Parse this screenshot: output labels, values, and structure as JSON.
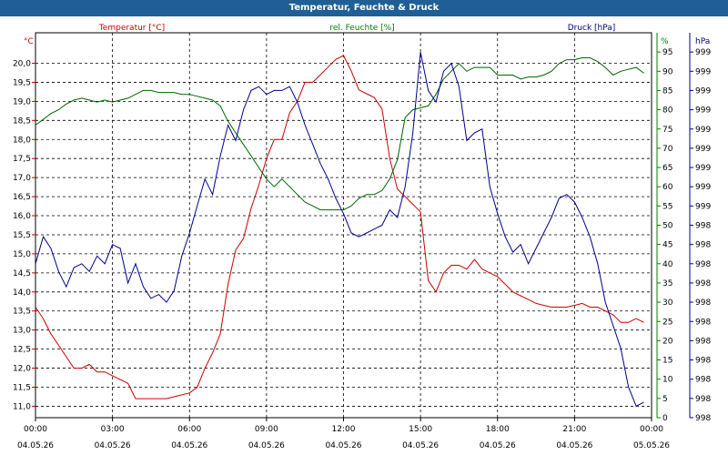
{
  "window": {
    "title": "Temperatur, Feuchte & Druck"
  },
  "chart_data": {
    "type": "line",
    "title": "Temperatur, Feuchte & Druck",
    "x_ticks": [
      {
        "time": "00:00",
        "date": "04.05.26"
      },
      {
        "time": "03:00",
        "date": "04.05.26"
      },
      {
        "time": "06:00",
        "date": "04.05.26"
      },
      {
        "time": "09:00",
        "date": "04.05.26"
      },
      {
        "time": "12:00",
        "date": "04.05.26"
      },
      {
        "time": "15:00",
        "date": "04.05.26"
      },
      {
        "time": "18:00",
        "date": "04.05.26"
      },
      {
        "time": "21:00",
        "date": "04.05.26"
      },
      {
        "time": "00:00",
        "date": "05.05.26"
      }
    ],
    "xlim": [
      0,
      24
    ],
    "axes": {
      "temperature": {
        "label": "Temperatur [°C]",
        "unit": "°C",
        "color": "#cc0000",
        "ylim": [
          10.7,
          20.8
        ],
        "ticks": [
          "11,0",
          "11,5",
          "12,0",
          "12,5",
          "13,0",
          "13,5",
          "14,0",
          "14,5",
          "15,0",
          "15,5",
          "16,0",
          "16,5",
          "17,0",
          "17,5",
          "18,0",
          "18,5",
          "19,0",
          "19,5",
          "20,0"
        ]
      },
      "humidity": {
        "label": "rel. Feuchte [%]",
        "unit": "%",
        "color": "#008000",
        "ylim": [
          0,
          100
        ],
        "ticks": [
          "0",
          "5",
          "10",
          "15",
          "20",
          "25",
          "30",
          "35",
          "40",
          "45",
          "50",
          "55",
          "60",
          "65",
          "70",
          "75",
          "80",
          "85",
          "90",
          "95"
        ]
      },
      "pressure": {
        "label": "Druck [hPa]",
        "unit": "hPa",
        "color": "#000080",
        "ticks": [
          "998",
          "998",
          "998",
          "998",
          "998",
          "998",
          "998",
          "998",
          "998",
          "998",
          "998",
          "999",
          "999",
          "999",
          "999",
          "999",
          "999",
          "999",
          "999",
          "999"
        ]
      }
    },
    "series": [
      {
        "name": "Temperatur [°C]",
        "axis": "temperature",
        "color": "#cc0000",
        "x": [
          0,
          0.3,
          0.6,
          0.9,
          1.2,
          1.5,
          1.8,
          2.1,
          2.4,
          2.7,
          3.0,
          3.3,
          3.6,
          3.9,
          4.2,
          4.5,
          4.8,
          5.1,
          5.4,
          5.7,
          6.0,
          6.3,
          6.6,
          6.9,
          7.2,
          7.5,
          7.8,
          8.1,
          8.4,
          8.7,
          9.0,
          9.3,
          9.6,
          9.9,
          10.2,
          10.5,
          10.8,
          11.1,
          11.4,
          11.7,
          12.0,
          12.3,
          12.6,
          12.9,
          13.2,
          13.5,
          13.8,
          14.1,
          14.4,
          14.7,
          15.0,
          15.3,
          15.6,
          15.9,
          16.2,
          16.5,
          16.8,
          17.1,
          17.4,
          17.7,
          18.0,
          18.3,
          18.6,
          18.9,
          19.2,
          19.5,
          19.8,
          20.1,
          20.4,
          20.7,
          21.0,
          21.3,
          21.6,
          21.9,
          22.2,
          22.5,
          22.8,
          23.1,
          23.4,
          23.7
        ],
        "values": [
          13.6,
          13.3,
          12.9,
          12.6,
          12.3,
          12.0,
          12.0,
          12.1,
          11.9,
          11.9,
          11.8,
          11.7,
          11.6,
          11.2,
          11.2,
          11.2,
          11.2,
          11.2,
          11.25,
          11.3,
          11.35,
          11.5,
          12.0,
          12.4,
          12.9,
          14.2,
          15.1,
          15.4,
          16.2,
          16.8,
          17.5,
          18.0,
          18.0,
          18.7,
          19.0,
          19.5,
          19.5,
          19.7,
          19.9,
          20.1,
          20.2,
          19.8,
          19.3,
          19.2,
          19.1,
          18.8,
          17.5,
          16.7,
          16.5,
          16.3,
          16.1,
          14.3,
          14.0,
          14.5,
          14.7,
          14.7,
          14.6,
          14.85,
          14.6,
          14.5,
          14.4,
          14.2,
          14.0,
          13.9,
          13.8,
          13.7,
          13.65,
          13.6,
          13.6,
          13.6,
          13.65,
          13.7,
          13.6,
          13.6,
          13.5,
          13.4,
          13.2,
          13.2,
          13.3,
          13.2
        ]
      },
      {
        "name": "rel. Feuchte [%]",
        "axis": "humidity",
        "color": "#006400",
        "x": [
          0,
          0.3,
          0.6,
          0.9,
          1.2,
          1.5,
          1.8,
          2.1,
          2.4,
          2.7,
          3.0,
          3.3,
          3.6,
          3.9,
          4.2,
          4.5,
          4.8,
          5.1,
          5.4,
          5.7,
          6.0,
          6.3,
          6.6,
          6.9,
          7.2,
          7.5,
          7.8,
          8.1,
          8.4,
          8.7,
          9.0,
          9.3,
          9.6,
          9.9,
          10.2,
          10.5,
          10.8,
          11.1,
          11.4,
          11.7,
          12.0,
          12.3,
          12.6,
          12.9,
          13.2,
          13.5,
          13.8,
          14.1,
          14.4,
          14.7,
          15.0,
          15.3,
          15.6,
          15.9,
          16.2,
          16.5,
          16.8,
          17.1,
          17.4,
          17.7,
          18.0,
          18.3,
          18.6,
          18.9,
          19.2,
          19.5,
          19.8,
          20.1,
          20.4,
          20.7,
          21.0,
          21.3,
          21.6,
          21.9,
          22.2,
          22.5,
          22.8,
          23.1,
          23.4,
          23.7
        ],
        "values": [
          76,
          77.5,
          79,
          80,
          81.5,
          82.5,
          83,
          82.5,
          82,
          82.5,
          82,
          82.5,
          83,
          84,
          85,
          85,
          84.5,
          84.5,
          84.5,
          84,
          84,
          83.5,
          83,
          82.5,
          81,
          77,
          74,
          71,
          68,
          65,
          62,
          60,
          62,
          60,
          58,
          56,
          55,
          54,
          54,
          54,
          54,
          55,
          57,
          58,
          58,
          59,
          62,
          67,
          78,
          80,
          80.5,
          81,
          84,
          88,
          90,
          92,
          90,
          91,
          91,
          91,
          89,
          89,
          89,
          88,
          88.5,
          88.5,
          89,
          90,
          92,
          93,
          93,
          93.5,
          93.5,
          92.5,
          91,
          89,
          90,
          90.5,
          91,
          89.5
        ]
      },
      {
        "name": "Druck [hPa]",
        "axis": "pressure",
        "color": "#000090",
        "x": [
          0,
          0.3,
          0.6,
          0.9,
          1.2,
          1.5,
          1.8,
          2.1,
          2.4,
          2.7,
          3.0,
          3.3,
          3.6,
          3.9,
          4.2,
          4.5,
          4.8,
          5.1,
          5.4,
          5.7,
          6.0,
          6.3,
          6.6,
          6.9,
          7.2,
          7.5,
          7.8,
          8.1,
          8.4,
          8.7,
          9.0,
          9.3,
          9.6,
          9.9,
          10.2,
          10.5,
          10.8,
          11.1,
          11.4,
          11.7,
          12.0,
          12.3,
          12.6,
          12.9,
          13.2,
          13.5,
          13.8,
          14.1,
          14.4,
          14.7,
          15.0,
          15.3,
          15.6,
          15.9,
          16.2,
          16.5,
          16.8,
          17.1,
          17.4,
          17.7,
          18.0,
          18.3,
          18.6,
          18.9,
          19.2,
          19.5,
          19.8,
          20.1,
          20.4,
          20.7,
          21.0,
          21.3,
          21.6,
          21.9,
          22.2,
          22.5,
          22.8,
          23.1,
          23.4,
          23.7
        ],
        "values": [
          40,
          47,
          44,
          38,
          34,
          39,
          40,
          38,
          42,
          40,
          45,
          44,
          35,
          40,
          34,
          31,
          32,
          30,
          33,
          42,
          48,
          55,
          62,
          58,
          68,
          76,
          72,
          80,
          85,
          86,
          84,
          85,
          85,
          86,
          82,
          76,
          71,
          66,
          62,
          57,
          53,
          48,
          47,
          48,
          49,
          50,
          54,
          52,
          60,
          74,
          95,
          85,
          82,
          90,
          92,
          86,
          72,
          74,
          75,
          60,
          53,
          47,
          43,
          45,
          40,
          44,
          48,
          52,
          57,
          58,
          56,
          52,
          47,
          40,
          30,
          24,
          18,
          8,
          3,
          4
        ]
      }
    ],
    "grid": true,
    "legend": "top"
  }
}
